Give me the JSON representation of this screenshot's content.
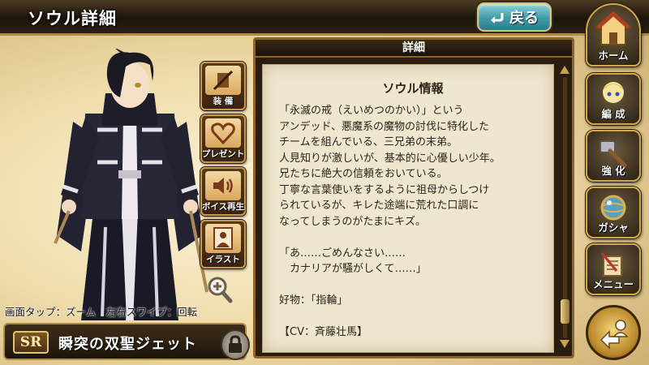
{
  "header": {
    "title": "ソウル詳細",
    "back_label": "戻る",
    "back_icon": "return-arrow-icon"
  },
  "actions": [
    {
      "label": "装 備",
      "icon": "no-equip-icon"
    },
    {
      "label": "プレゼント",
      "icon": "heart-gift-icon"
    },
    {
      "label": "ボイス再生",
      "icon": "speaker-icon"
    },
    {
      "label": "イラスト",
      "icon": "portrait-icon"
    }
  ],
  "hint": "画面タップ：ズーム　左右スワイプ：回転",
  "soul": {
    "rarity": "SR",
    "name": "瞬突の双聖ジェット"
  },
  "panel": {
    "tab_label": "詳細",
    "info_title": "ソウル情報",
    "description": "「永滅の戒（えいめつのかい）」という\nアンデッド、悪魔系の魔物の討伐に特化した\nチームを組んでいる、三兄弟の末弟。\n人見知りが激しいが、基本的に心優しい少年。\n兄たちに絶大の信頼をおいている。\n丁寧な言葉使いをするように祖母からしつけ\nられているが、キレた途端に荒れた口調に\nなってしまうのがたまにキズ。\n\n「あ……ごめんなさい……\n　カナリアが騒がしくて……」\n\n好物：「指輪」\n\n【CV：斉藤壮馬】"
  },
  "menu": [
    {
      "label": "ホーム",
      "icon": "house-icon"
    },
    {
      "label": "編 成",
      "icon": "party-icon"
    },
    {
      "label": "強 化",
      "icon": "hammer-icon"
    },
    {
      "label": "ガシャ",
      "icon": "orb-icon"
    },
    {
      "label": "メニュー",
      "icon": "scroll-quill-icon"
    }
  ],
  "colors": {
    "header_bg": "#1c140a",
    "back_button": "#3f9aa8",
    "gold_border": "#c69a4a",
    "paper": "#efe6cf"
  }
}
